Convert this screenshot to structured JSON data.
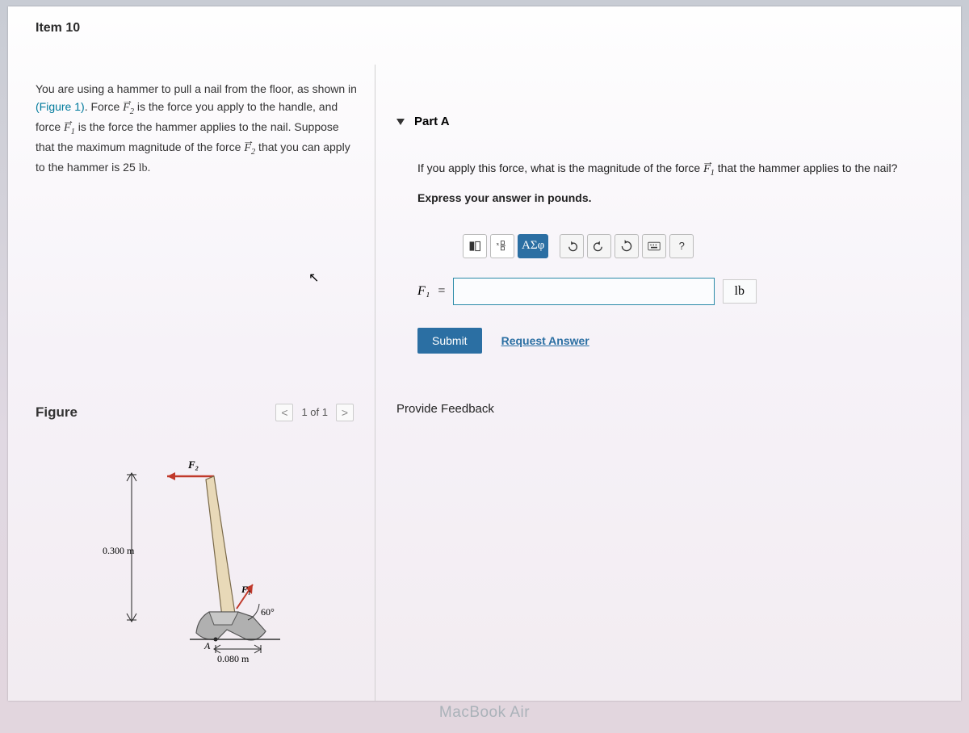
{
  "item_title": "Item 10",
  "problem": {
    "line1_a": "You are using a hammer to pull a nail from the floor, as shown in",
    "fig_link": "(Figure 1)",
    "line2_a": ". Force ",
    "f2": "F",
    "sub2": "2",
    "line2_b": " is the force you apply to the handle, and",
    "line3_a": "force ",
    "f1": "F",
    "sub1": "1",
    "line3_b": " is the force the hammer applies to the nail. Suppose",
    "line4_a": "that the maximum magnitude of the force ",
    "line4_b": " that you can apply",
    "line5": "to the hammer is 25 ",
    "unit_lb": "lb",
    "line5_end": "."
  },
  "figure": {
    "label": "Figure",
    "pager": "1 of 1",
    "dims": {
      "height": "0.300 m",
      "base": "0.080 m",
      "angle": "60°",
      "point_a": "A",
      "f1_label": "F₁",
      "f2_label": "F₂"
    }
  },
  "right": {
    "part_title": "Part A",
    "question_a": "If you apply this force, what is the magnitude of the force ",
    "question_f": "F",
    "question_sub": "1",
    "question_b": " that the hammer applies to the nail?",
    "instruction": "Express your answer in pounds.",
    "greek_label": "ΑΣφ",
    "help_q": "?",
    "var_label": "F₁",
    "equals": "=",
    "unit": "lb",
    "submit": "Submit",
    "request": "Request Answer",
    "feedback": "Provide Feedback"
  },
  "device": "MacBook Air"
}
